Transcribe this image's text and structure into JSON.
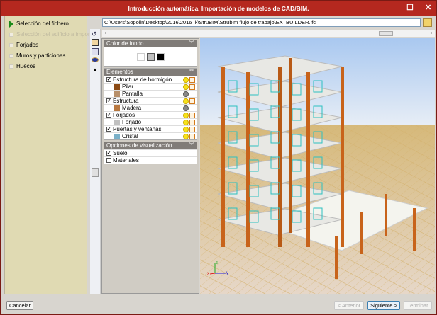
{
  "window": {
    "title": "Introducción automática. Importación de modelos de CAD/BIM."
  },
  "steps": [
    {
      "label": "Selección del fichero",
      "state": "active"
    },
    {
      "label": "Selección del edificio a importar",
      "state": "disabled"
    },
    {
      "label": "Forjados",
      "state": "normal"
    },
    {
      "label": "Muros y particiones",
      "state": "normal"
    },
    {
      "label": "Huecos",
      "state": "normal"
    }
  ],
  "file_path": "C:\\Users\\Sopolin\\Desktop\\2016\\2016_k\\StruBIM\\Strubim flujo de trabajo\\EX_BUILDER.ifc",
  "panel": {
    "background": {
      "title": "Color de fondo",
      "colors": [
        "#ffffff",
        "#c0c0c0",
        "#000000"
      ]
    },
    "elements": {
      "title": "Elementos",
      "rows": [
        {
          "label": "Estructura de hormigón",
          "type": "group",
          "checked": true,
          "visible": true
        },
        {
          "label": "Pilar",
          "type": "item",
          "color": "#8b4a14",
          "visible": true
        },
        {
          "label": "Pantalla",
          "type": "item",
          "color": "#b8906a",
          "visible": false
        },
        {
          "label": "Estructura",
          "type": "group",
          "checked": true,
          "visible": true
        },
        {
          "label": "Madera",
          "type": "item",
          "color": "#b87840",
          "visible": false
        },
        {
          "label": "Forjados",
          "type": "group",
          "checked": true,
          "visible": true
        },
        {
          "label": "Forjado",
          "type": "item",
          "color": "#c0c0c0",
          "visible": true
        },
        {
          "label": "Puertas y ventanas",
          "type": "group",
          "checked": true,
          "visible": true
        },
        {
          "label": "Cristal",
          "type": "item",
          "color": "#7ab0c8",
          "visible": true
        }
      ]
    },
    "view_options": {
      "title": "Opciones de visualización",
      "rows": [
        {
          "label": "Suelo",
          "checked": true
        },
        {
          "label": "Materiales",
          "checked": false
        }
      ]
    }
  },
  "axes": {
    "x": "x",
    "y": "y",
    "z": "z"
  },
  "buttons": {
    "cancel": "Cancelar",
    "back": "< Anterior",
    "next": "Siguiente >",
    "finish": "Terminar"
  }
}
